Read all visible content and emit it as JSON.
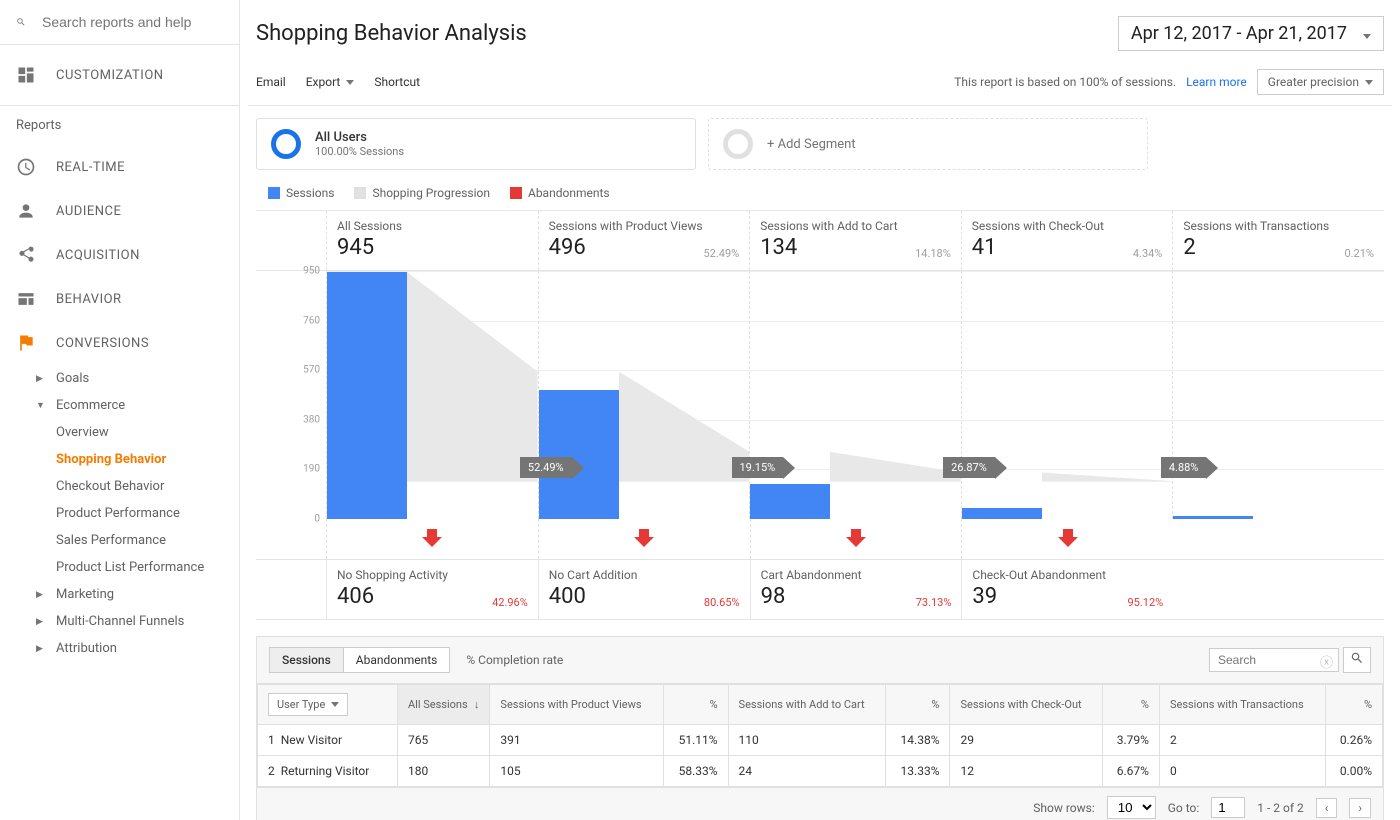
{
  "search": {
    "placeholder": "Search reports and help"
  },
  "nav": {
    "customization": "CUSTOMIZATION",
    "reports": "Reports",
    "realtime": "REAL-TIME",
    "audience": "AUDIENCE",
    "acquisition": "ACQUISITION",
    "behavior": "BEHAVIOR",
    "conversions": "CONVERSIONS",
    "goals": "Goals",
    "ecommerce": "Ecommerce",
    "overview": "Overview",
    "shopping_behavior": "Shopping Behavior",
    "checkout_behavior": "Checkout Behavior",
    "product_performance": "Product Performance",
    "sales_performance": "Sales Performance",
    "product_list_performance": "Product List Performance",
    "marketing": "Marketing",
    "multi_channel": "Multi-Channel Funnels",
    "attribution": "Attribution"
  },
  "header": {
    "title": "Shopping Behavior Analysis",
    "date_range": "Apr 12, 2017 - Apr 21, 2017"
  },
  "toolbar": {
    "email": "Email",
    "export": "Export",
    "shortcut": "Shortcut",
    "report_note": "This report is based on 100% of sessions.",
    "learn_more": "Learn more",
    "precision": "Greater precision"
  },
  "segment": {
    "all_users": "All Users",
    "all_users_sub": "100.00% Sessions",
    "add_segment": "+ Add Segment"
  },
  "legend": {
    "sessions": "Sessions",
    "progression": "Shopping Progression",
    "abandonments": "Abandonments"
  },
  "funnel": {
    "ticks": [
      "950",
      "760",
      "570",
      "380",
      "190",
      "0"
    ],
    "steps": [
      {
        "label": "All Sessions",
        "value": "945",
        "pct": ""
      },
      {
        "label": "Sessions with Product Views",
        "value": "496",
        "pct": "52.49%"
      },
      {
        "label": "Sessions with Add to Cart",
        "value": "134",
        "pct": "14.18%"
      },
      {
        "label": "Sessions with Check-Out",
        "value": "41",
        "pct": "4.34%"
      },
      {
        "label": "Sessions with Transactions",
        "value": "2",
        "pct": "0.21%"
      }
    ],
    "prog": [
      "52.49%",
      "19.15%",
      "26.87%",
      "4.88%"
    ],
    "aband": [
      {
        "label": "No Shopping Activity",
        "value": "406",
        "pct": "42.96%"
      },
      {
        "label": "No Cart Addition",
        "value": "400",
        "pct": "80.65%"
      },
      {
        "label": "Cart Abandonment",
        "value": "98",
        "pct": "73.13%"
      },
      {
        "label": "Check-Out Abandonment",
        "value": "39",
        "pct": "95.12%"
      }
    ]
  },
  "chart_data": {
    "type": "bar",
    "categories": [
      "All Sessions",
      "Sessions with Product Views",
      "Sessions with Add to Cart",
      "Sessions with Check-Out",
      "Sessions with Transactions"
    ],
    "values": [
      945,
      496,
      134,
      41,
      2
    ],
    "progression_pct": [
      52.49,
      19.15,
      26.87,
      4.88
    ],
    "abandonment": [
      {
        "label": "No Shopping Activity",
        "value": 406,
        "pct": 42.96
      },
      {
        "label": "No Cart Addition",
        "value": 400,
        "pct": 80.65
      },
      {
        "label": "Cart Abandonment",
        "value": 98,
        "pct": 73.13
      },
      {
        "label": "Check-Out Abandonment",
        "value": 39,
        "pct": 95.12
      }
    ],
    "ylim": [
      0,
      950
    ],
    "ylabel": "Sessions"
  },
  "table": {
    "tabs": {
      "sessions": "Sessions",
      "abandonments": "Abandonments"
    },
    "completion": "% Completion rate",
    "search_placeholder": "Search",
    "usertype": "User Type",
    "columns": {
      "all_sessions": "All Sessions",
      "product_views": "Sessions with Product Views",
      "add_to_cart": "Sessions with Add to Cart",
      "checkout": "Sessions with Check-Out",
      "transactions": "Sessions with Transactions",
      "pct": "%"
    },
    "rows": [
      {
        "idx": "1",
        "type": "New Visitor",
        "all": "765",
        "pv": "391",
        "pv_pct": "51.11%",
        "cart": "110",
        "cart_pct": "14.38%",
        "co": "29",
        "co_pct": "3.79%",
        "tx": "2",
        "tx_pct": "0.26%"
      },
      {
        "idx": "2",
        "type": "Returning Visitor",
        "all": "180",
        "pv": "105",
        "pv_pct": "58.33%",
        "cart": "24",
        "cart_pct": "13.33%",
        "co": "12",
        "co_pct": "6.67%",
        "tx": "0",
        "tx_pct": "0.00%"
      }
    ],
    "footer": {
      "show_rows": "Show rows:",
      "rows_val": "10",
      "goto": "Go to:",
      "goto_val": "1",
      "range": "1 - 2 of 2"
    }
  }
}
